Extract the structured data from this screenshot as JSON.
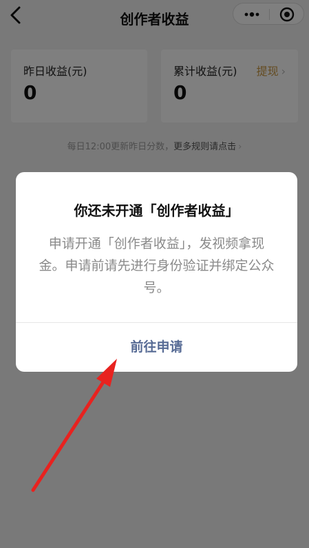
{
  "nav": {
    "title": "创作者收益"
  },
  "cards": {
    "yesterday": {
      "label": "昨日收益(元)",
      "value": "0"
    },
    "total": {
      "label": "累计收益(元)",
      "value": "0",
      "action": "提现"
    }
  },
  "rules": {
    "text": "每日12:00更新昨日分数，",
    "link": "更多规则请点击"
  },
  "dialog": {
    "title": "你还未开通「创作者收益」",
    "body": "申请开通「创作者收益」，发视频拿现金。申请前请先进行身份验证并绑定公众号。",
    "button": "前往申请"
  },
  "icons": {
    "back": "chevron-left-icon",
    "more": "more-dots-icon",
    "close": "target-close-icon",
    "arrow": "annotation-arrow"
  },
  "colors": {
    "accent_link": "#576b95",
    "withdraw": "#c9963f",
    "arrow": "#e8221f"
  }
}
